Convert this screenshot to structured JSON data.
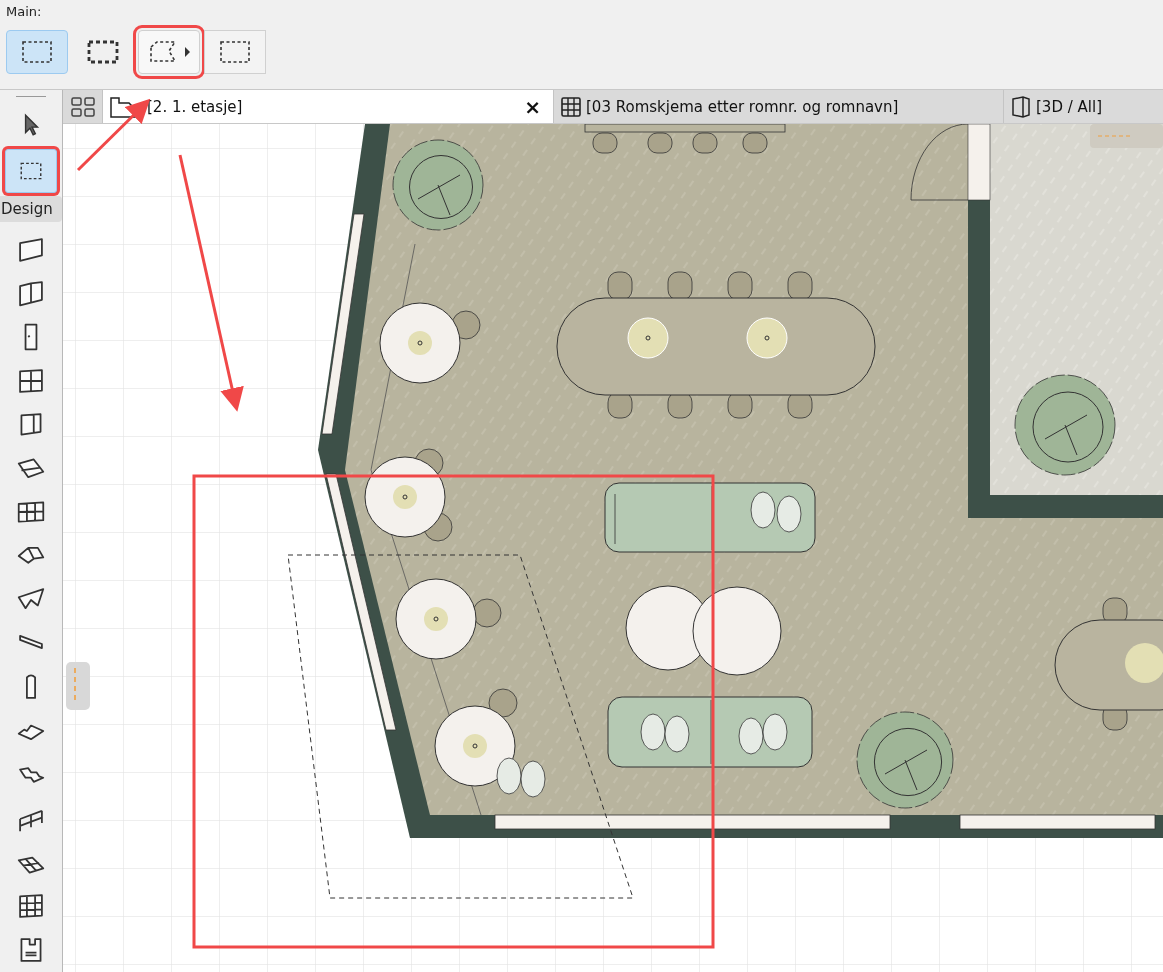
{
  "main_toolbar": {
    "label": "Main:",
    "buttons": [
      {
        "kind": "marquee-thin",
        "selected": true,
        "highlighted": false
      },
      {
        "kind": "marquee-bold",
        "selected": false,
        "highlighted": false
      },
      {
        "kind": "marquee-polygon",
        "selected": false,
        "highlighted": true
      },
      {
        "kind": "marquee-framed",
        "selected": false,
        "highlighted": false
      }
    ]
  },
  "toolbox": {
    "top_tools": [
      {
        "kind": "arrow",
        "selected": false,
        "highlighted": false
      },
      {
        "kind": "marquee",
        "selected": true,
        "highlighted": true
      }
    ],
    "section_label": "Design",
    "design_tools": [
      {
        "kind": "wall"
      },
      {
        "kind": "curtain"
      },
      {
        "kind": "door"
      },
      {
        "kind": "window"
      },
      {
        "kind": "corner-window"
      },
      {
        "kind": "skylight"
      },
      {
        "kind": "curtain-wall"
      },
      {
        "kind": "roof"
      },
      {
        "kind": "shell"
      },
      {
        "kind": "beam"
      },
      {
        "kind": "column"
      },
      {
        "kind": "slab"
      },
      {
        "kind": "stair"
      },
      {
        "kind": "railing"
      },
      {
        "kind": "mesh"
      },
      {
        "kind": "grid"
      },
      {
        "kind": "object"
      }
    ]
  },
  "tabs": [
    {
      "kind": "floorplan",
      "label": "[2. 1. etasje]",
      "selected": true,
      "close": "×"
    },
    {
      "kind": "schedule",
      "label": "[03 Romskjema etter romnr. og romnavn]",
      "selected": false
    },
    {
      "kind": "model",
      "label": "[3D / All]",
      "selected": false
    }
  ]
}
